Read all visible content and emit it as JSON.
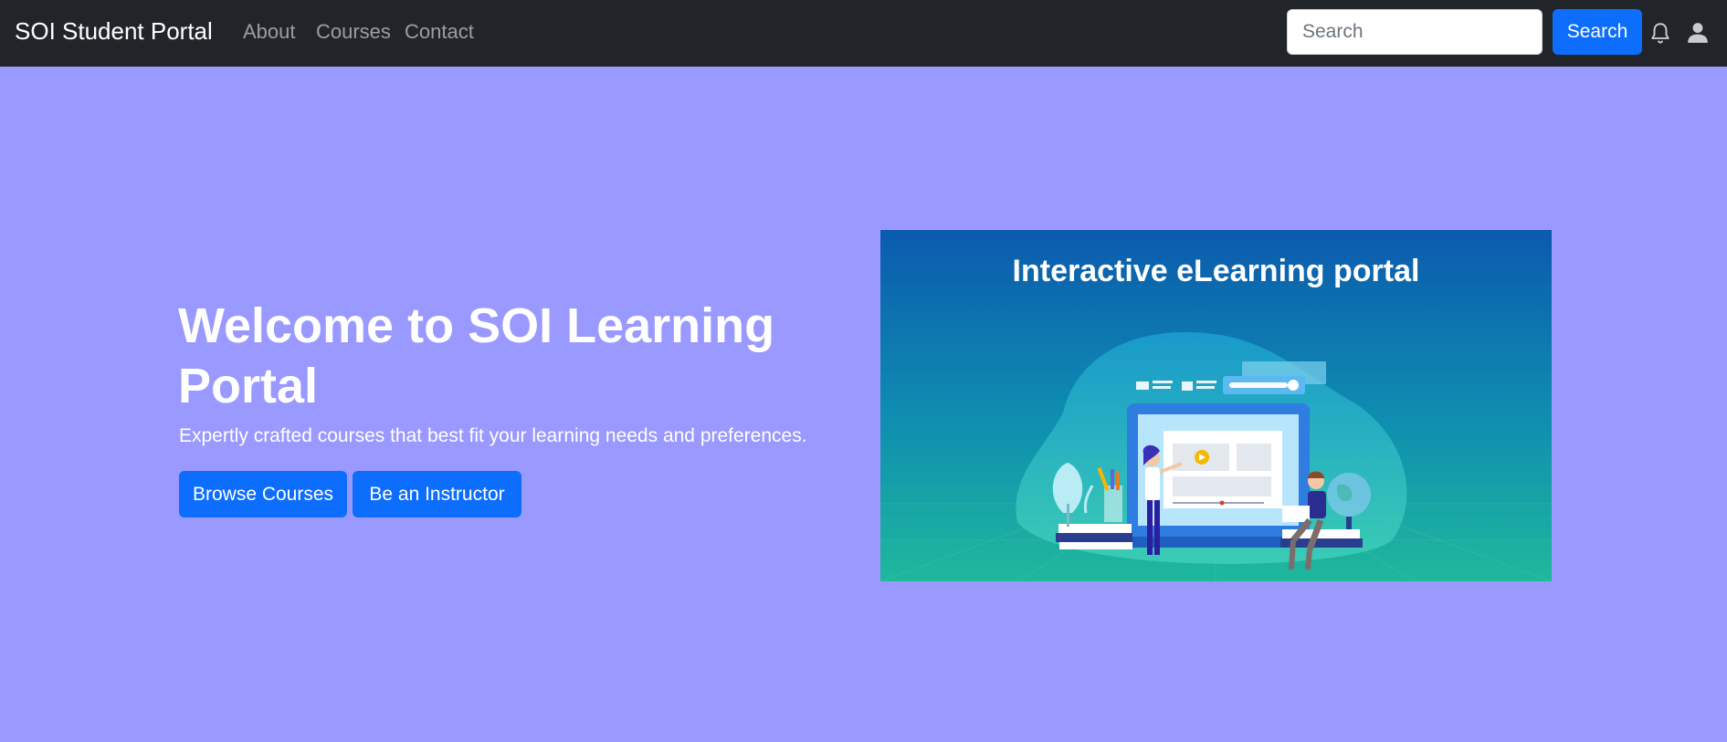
{
  "navbar": {
    "brand": "SOI Student Portal",
    "links": [
      "About",
      "Courses",
      "Contact"
    ],
    "search_placeholder": "Search",
    "search_button": "Search",
    "icons": [
      "bell-icon",
      "user-icon"
    ]
  },
  "hero": {
    "title": "Welcome to SOI Learning Portal",
    "subtitle": "Expertly crafted courses that best fit your learning needs and preferences.",
    "buttons": [
      "Browse Courses",
      "Be an Instructor"
    ],
    "image_title": "Interactive eLearning portal"
  },
  "colors": {
    "navbar_bg": "#212529",
    "page_bg": "#9999ff",
    "primary": "#0d6efd"
  }
}
